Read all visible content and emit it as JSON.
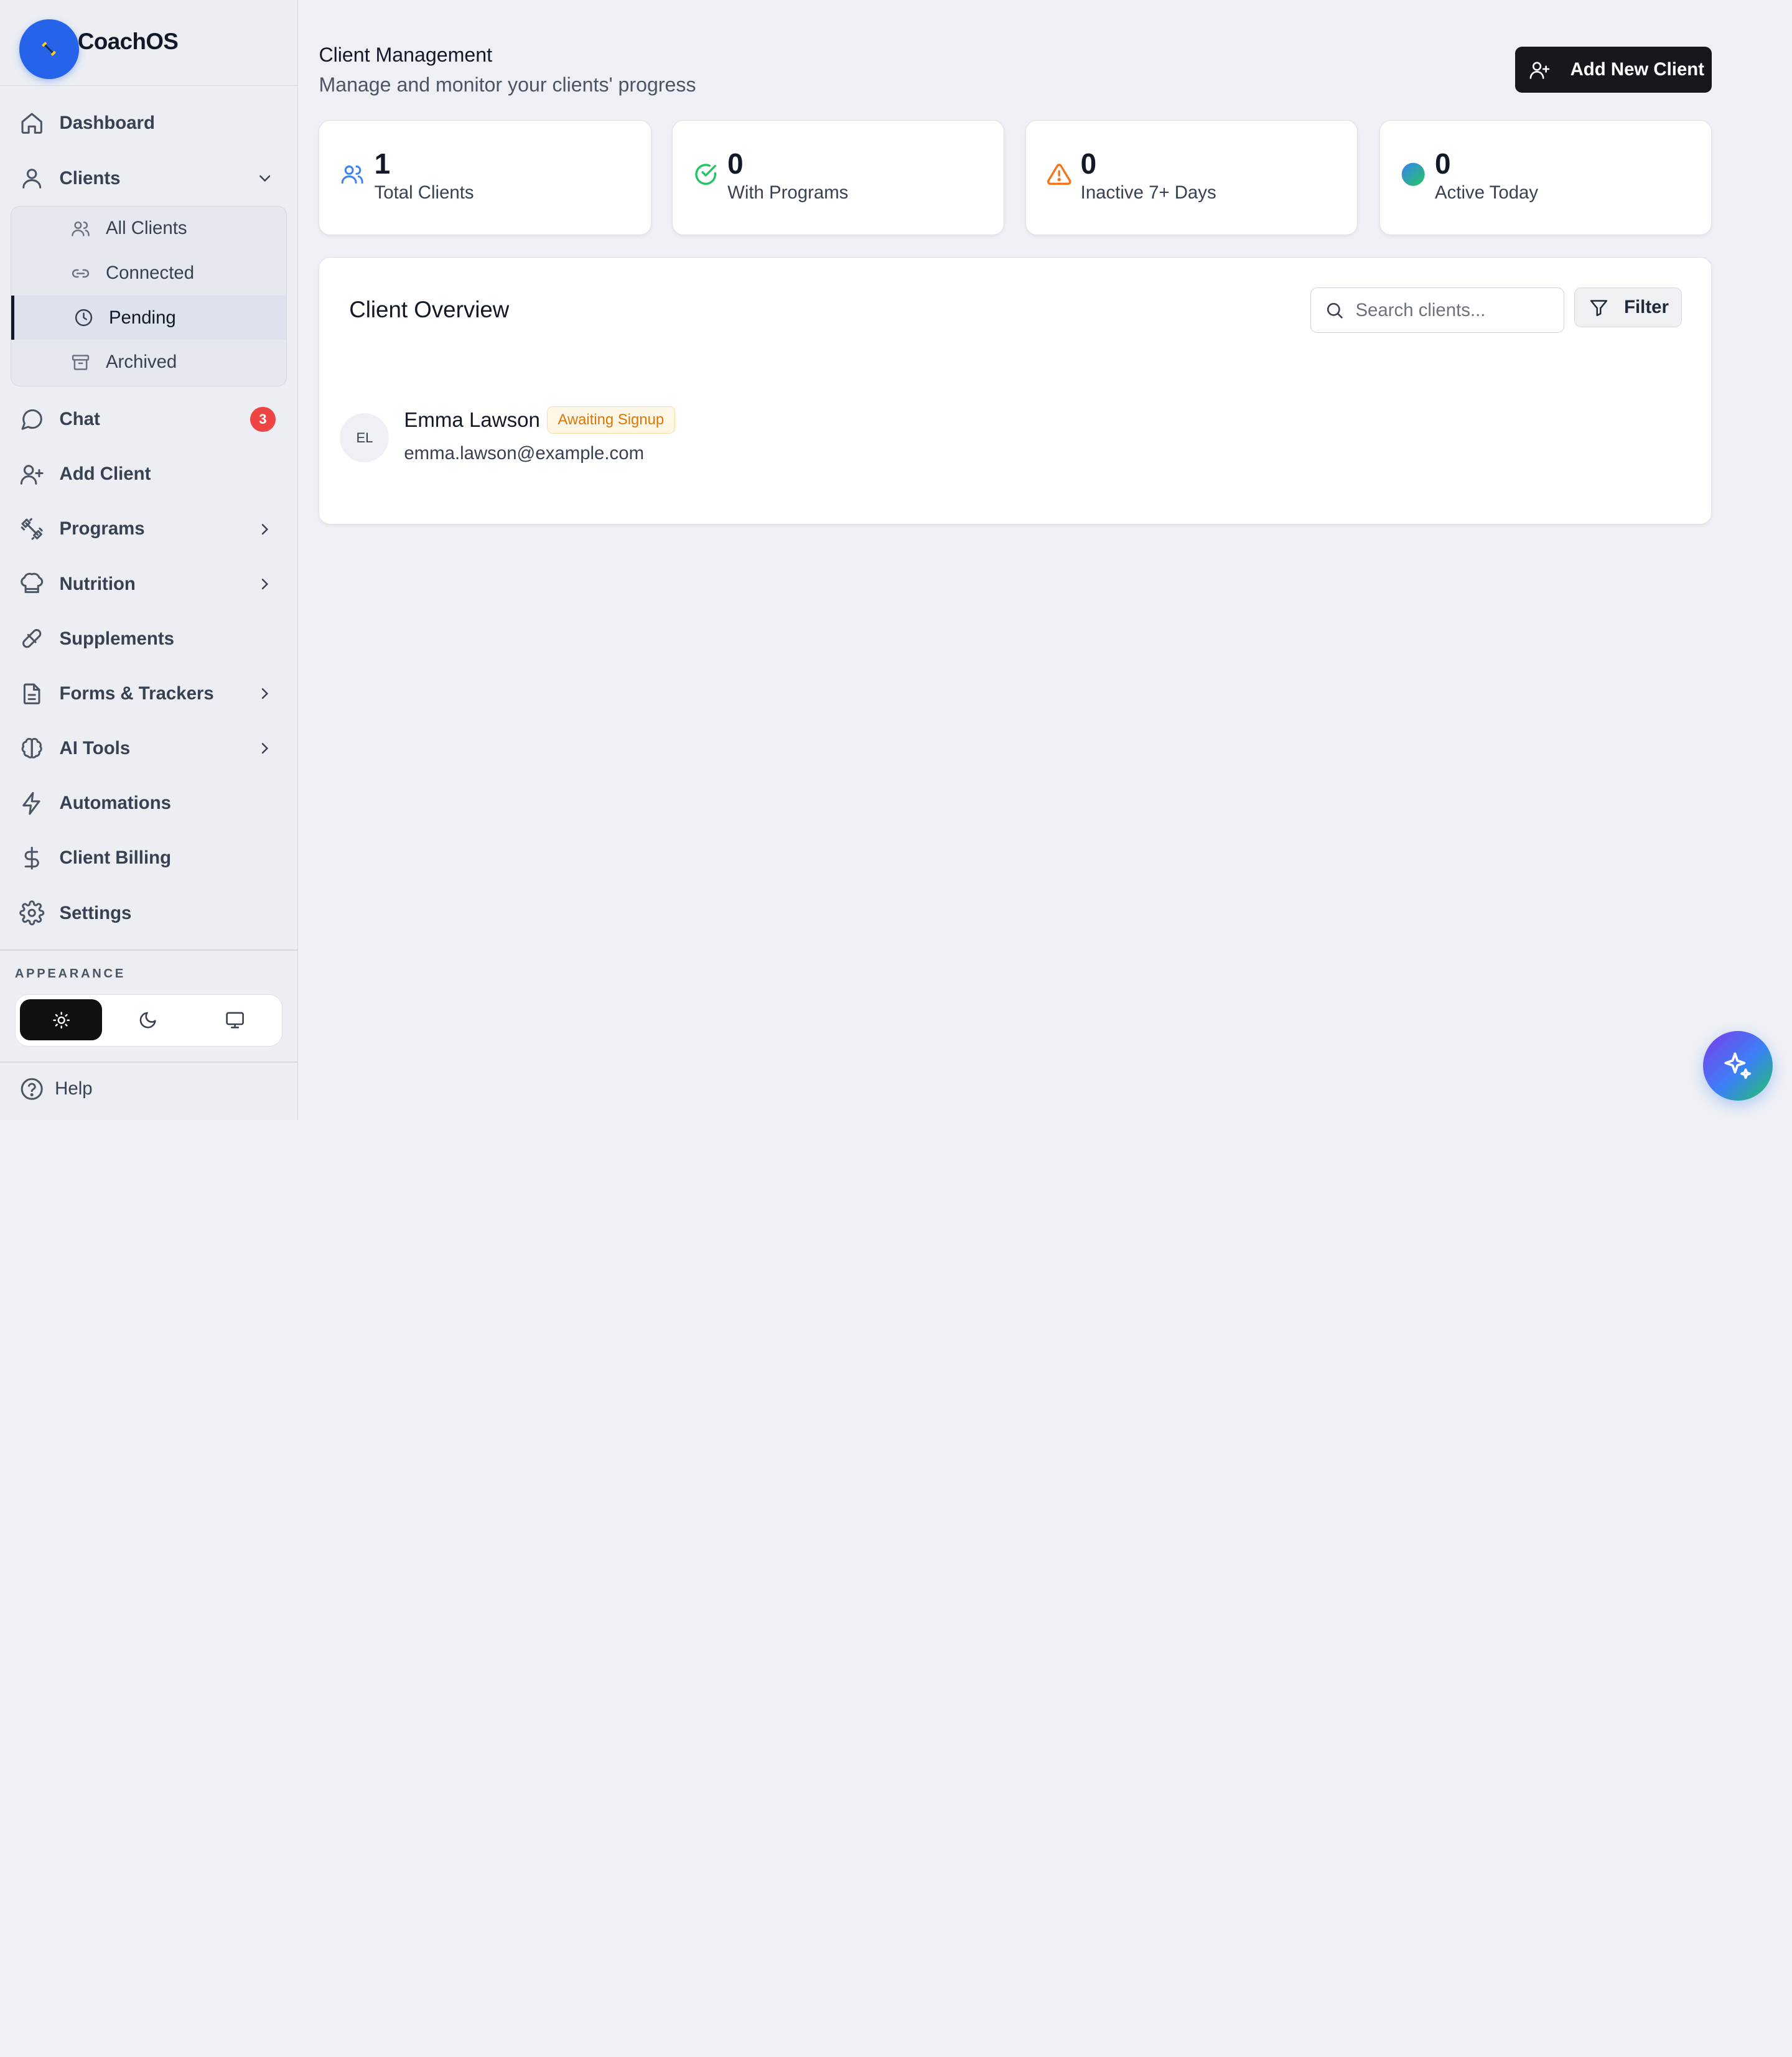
{
  "app": {
    "name": "CoachOS"
  },
  "sidebar": {
    "items": [
      {
        "label": "Dashboard",
        "icon": "home-icon"
      },
      {
        "label": "Clients",
        "icon": "user-icon",
        "expanded": true
      },
      {
        "label": "Chat",
        "icon": "chat-icon",
        "badge": "3"
      },
      {
        "label": "Add Client",
        "icon": "user-plus-icon"
      },
      {
        "label": "Programs",
        "icon": "dumbbell-icon"
      },
      {
        "label": "Nutrition",
        "icon": "chef-hat-icon"
      },
      {
        "label": "Supplements",
        "icon": "pill-icon"
      },
      {
        "label": "Forms & Trackers",
        "icon": "document-icon"
      },
      {
        "label": "AI Tools",
        "icon": "brain-icon"
      },
      {
        "label": "Automations",
        "icon": "lightning-icon"
      },
      {
        "label": "Client Billing",
        "icon": "dollar-icon"
      },
      {
        "label": "Settings",
        "icon": "gear-icon"
      }
    ],
    "clients_sub": [
      {
        "label": "All Clients",
        "icon": "users-icon"
      },
      {
        "label": "Connected",
        "icon": "link-icon"
      },
      {
        "label": "Pending",
        "icon": "clock-icon",
        "active": true
      },
      {
        "label": "Archived",
        "icon": "archive-icon"
      }
    ],
    "appearance_label": "APPEARANCE",
    "theme_options": [
      "light",
      "dark",
      "system"
    ],
    "theme_selected": "light",
    "help": "Help"
  },
  "header": {
    "title": "Client Management",
    "subtitle": "Manage and monitor your clients' progress",
    "add_button": "Add New Client"
  },
  "stats": [
    {
      "value": "1",
      "label": "Total Clients",
      "icon": "users-icon",
      "color": "#3b82f6"
    },
    {
      "value": "0",
      "label": "With Programs",
      "icon": "check-circle-icon",
      "color": "#22c55e"
    },
    {
      "value": "0",
      "label": "Inactive 7+ Days",
      "icon": "warning-icon",
      "color": "#f97316"
    },
    {
      "value": "0",
      "label": "Active Today",
      "icon": "status-dot-icon",
      "color": "#14b8a6"
    }
  ],
  "overview": {
    "title": "Client Overview",
    "search_placeholder": "Search clients...",
    "filter_label": "Filter",
    "clients": [
      {
        "initials": "EL",
        "name": "Emma Lawson",
        "status": "Awaiting Signup",
        "email": "emma.lawson@example.com"
      }
    ]
  },
  "colors": {
    "accent": "#2563eb",
    "dark": "#16181d",
    "badge": "#ef4444",
    "status_warn": "#d97706"
  }
}
